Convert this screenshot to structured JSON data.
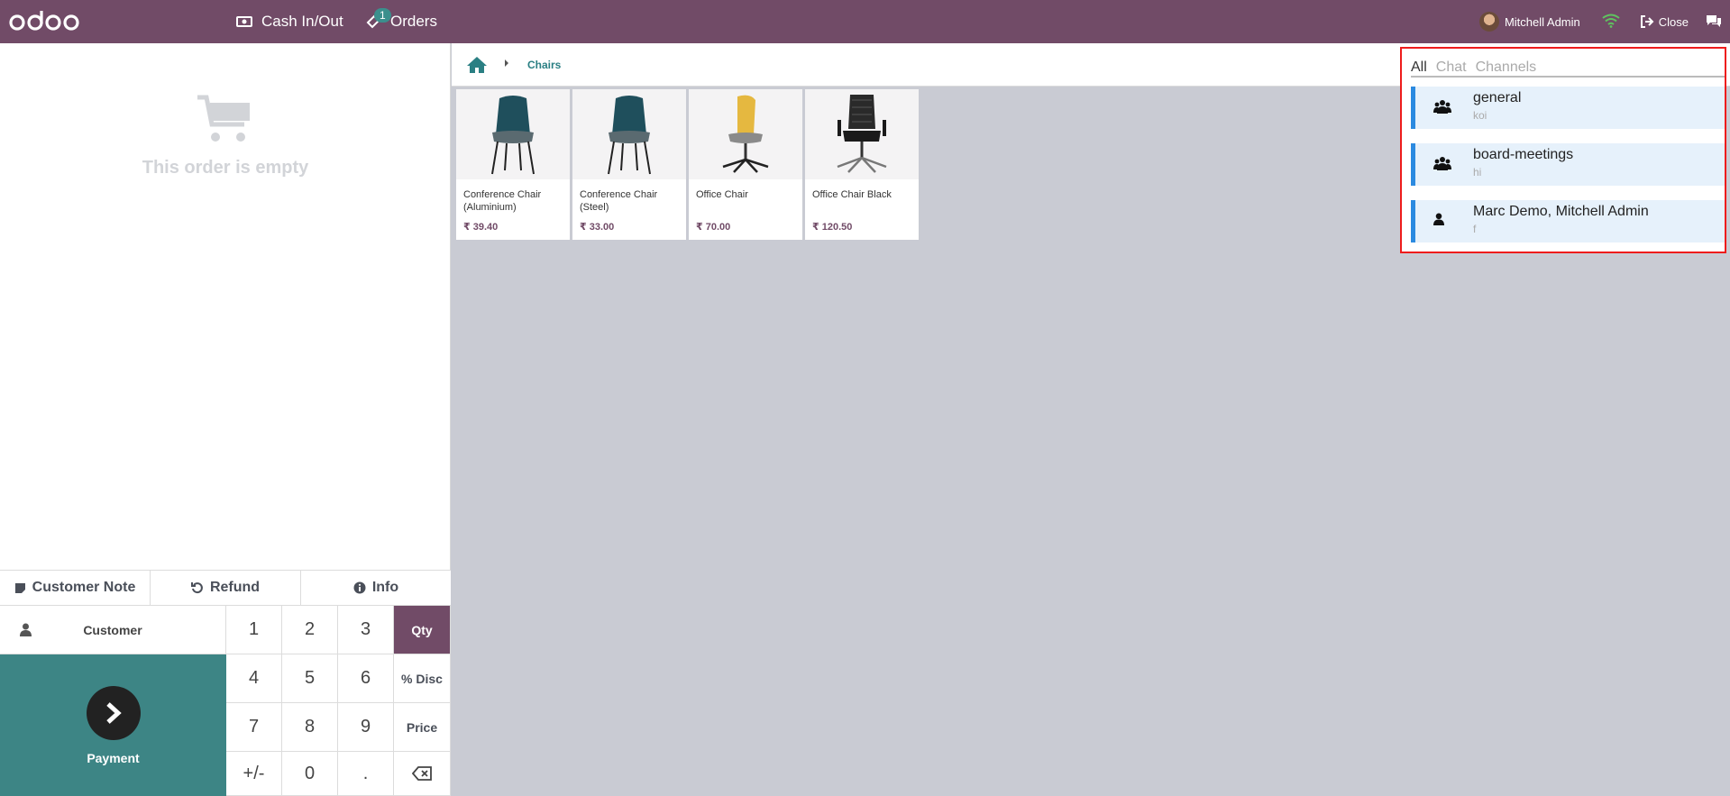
{
  "topbar": {
    "logo_text": "odoo",
    "cash_label": "Cash In/Out",
    "orders_label": "Orders",
    "orders_badge": "1",
    "user_name": "Mitchell Admin",
    "close_label": "Close",
    "brand_color": "#714b67"
  },
  "order": {
    "empty_text": "This order is empty"
  },
  "controls": {
    "customer_note": "Customer Note",
    "refund": "Refund",
    "info": "Info",
    "customer": "Customer",
    "payment": "Payment"
  },
  "numpad": {
    "keys": [
      "1",
      "2",
      "3",
      "Qty",
      "4",
      "5",
      "6",
      "% Disc",
      "7",
      "8",
      "9",
      "Price",
      "+/-",
      "0",
      ".",
      ""
    ]
  },
  "breadcrumb": {
    "category": "Chairs"
  },
  "products": [
    {
      "name": "Conference Chair (Aluminium)",
      "price": "₹ 39.40",
      "icon": "teal-chair-icon"
    },
    {
      "name": "Conference Chair (Steel)",
      "price": "₹ 33.00",
      "icon": "teal-chair-icon"
    },
    {
      "name": "Office Chair",
      "price": "₹ 70.00",
      "icon": "yellow-office-chair-icon"
    },
    {
      "name": "Office Chair Black",
      "price": "₹ 120.50",
      "icon": "black-office-chair-icon"
    }
  ],
  "messaging": {
    "tabs": [
      "All",
      "Chat",
      "Channels"
    ],
    "threads": [
      {
        "name": "general",
        "preview": "koi",
        "icon": "group-icon"
      },
      {
        "name": "board-meetings",
        "preview": "hi",
        "icon": "group-icon"
      },
      {
        "name": "Marc Demo, Mitchell Admin",
        "preview": "f",
        "icon": "user-icon"
      }
    ]
  }
}
